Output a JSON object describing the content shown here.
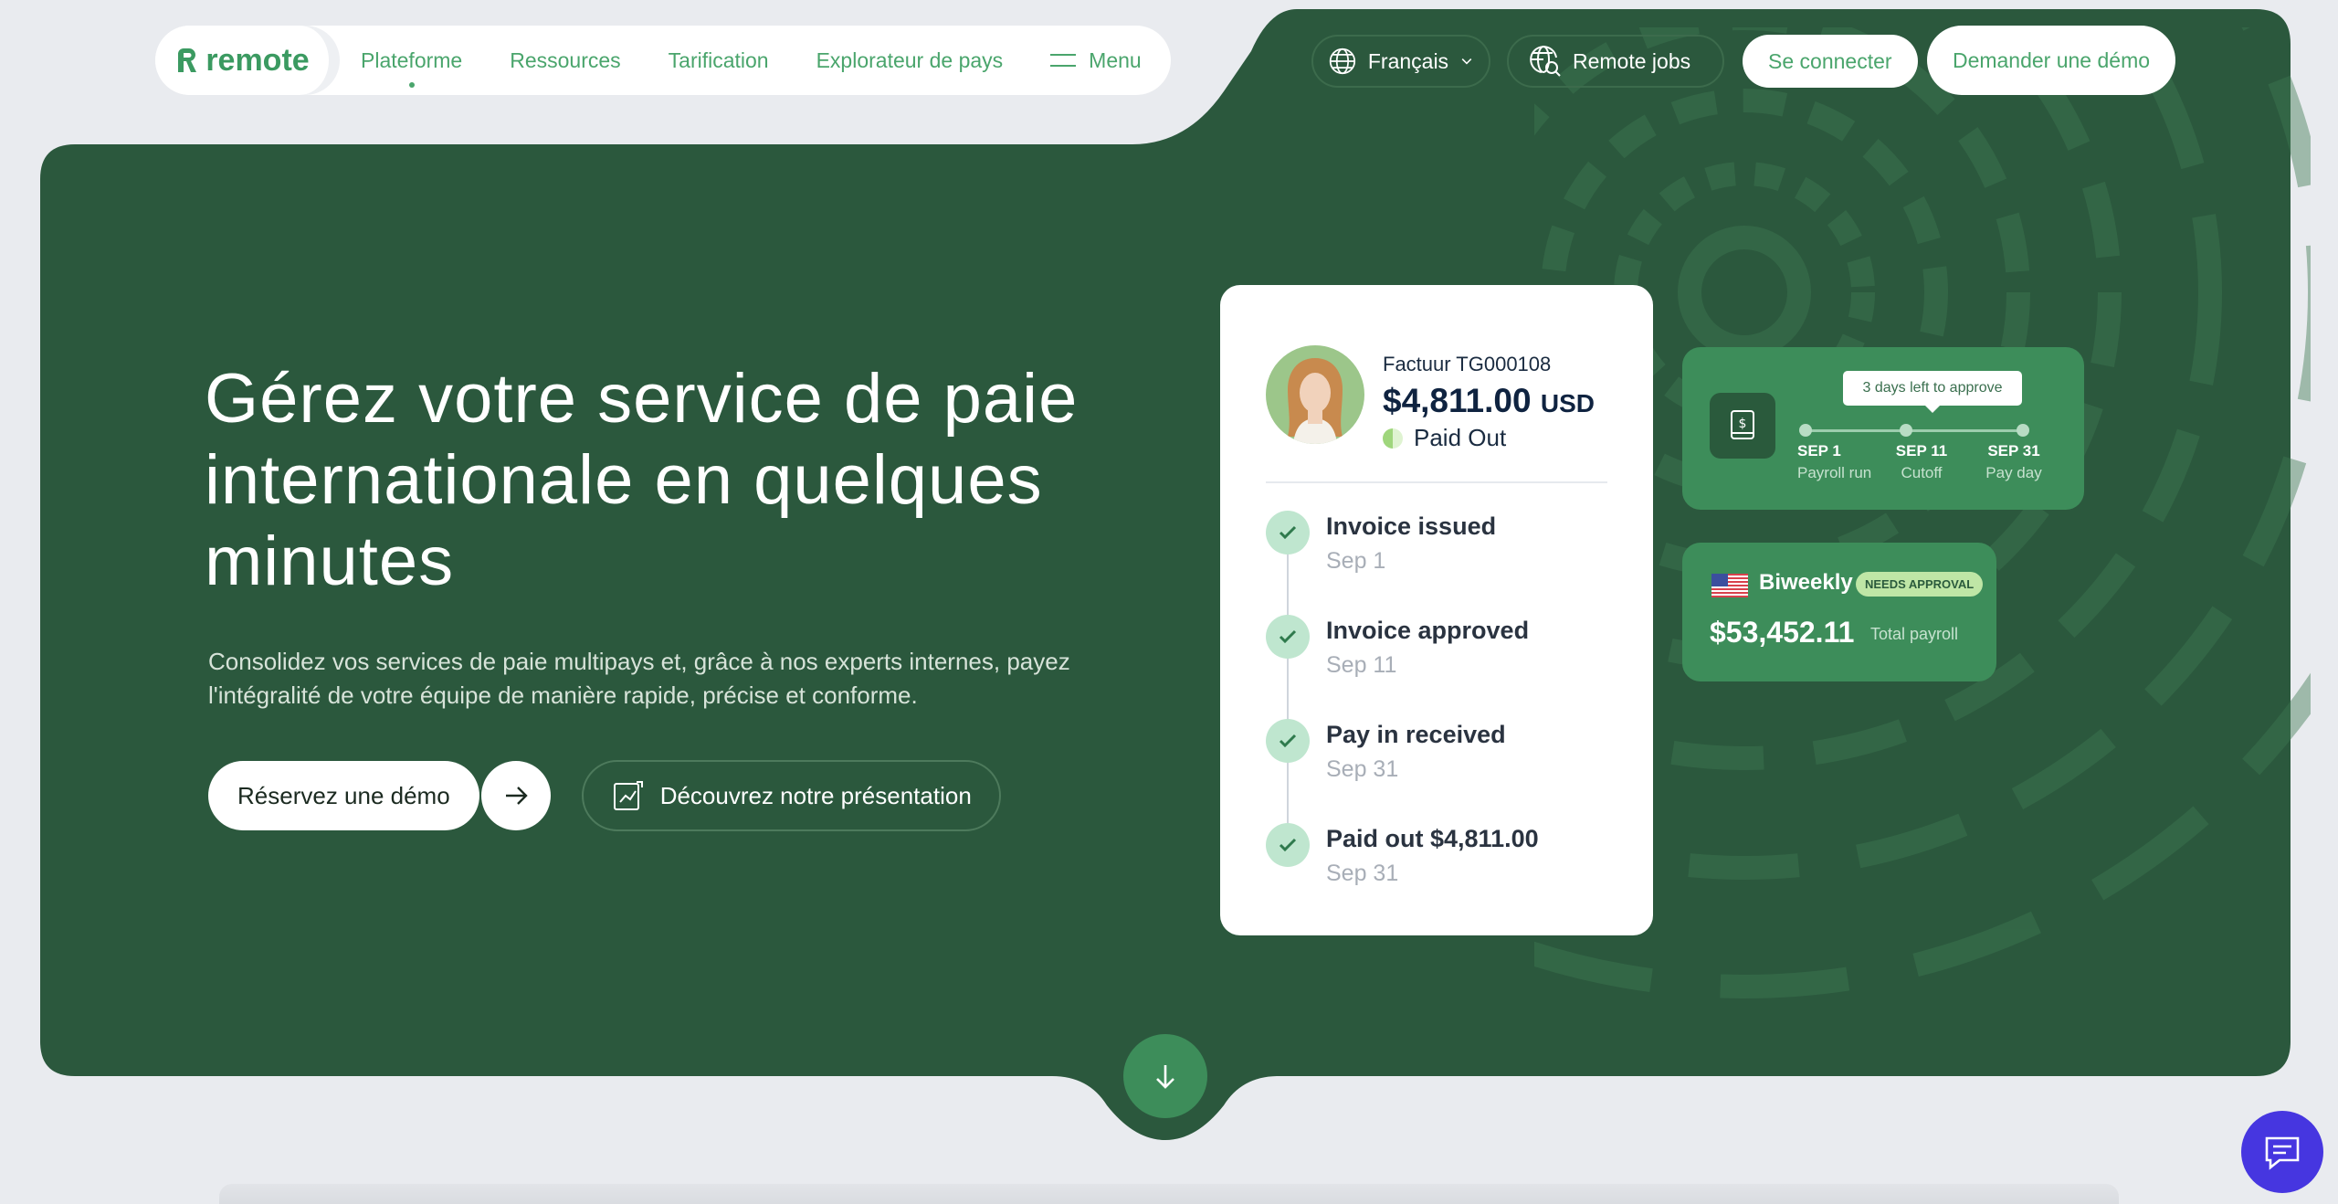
{
  "brand": {
    "name": "remote",
    "color": "#3b9a61",
    "dark_green": "#2a5a3c",
    "hero_bg": "#2b583d",
    "chat_color": "#4636e0"
  },
  "nav": {
    "items": [
      {
        "label": "Plateforme",
        "active": true
      },
      {
        "label": "Ressources"
      },
      {
        "label": "Tarification"
      },
      {
        "label": "Explorateur de pays"
      }
    ],
    "menu_label": "Menu",
    "language": "Français",
    "remote_jobs": "Remote jobs",
    "login": "Se connecter",
    "demo": "Demander une démo"
  },
  "hero": {
    "title": "Gérez votre service de paie internationale en quelques minutes",
    "subtitle": "Consolidez vos services de paie multipays et, grâce à nos experts internes, payez l'intégralité de votre équipe de manière rapide, précise et conforme.",
    "cta_primary": "Réservez une démo",
    "cta_secondary": "Découvrez notre présentation"
  },
  "invoice_card": {
    "invoice_no": "Factuur TG000108",
    "amount": "$4,811.00",
    "currency": "USD",
    "status": "Paid Out",
    "steps": [
      {
        "title": "Invoice issued",
        "date": "Sep 1"
      },
      {
        "title": "Invoice approved",
        "date": "Sep 11"
      },
      {
        "title": "Pay in received",
        "date": "Sep 31"
      },
      {
        "title": "Paid out $4,811.00",
        "date": "Sep 31"
      }
    ]
  },
  "payroll_timeline": {
    "tooltip": "3 days left to approve",
    "points": [
      {
        "date": "SEP 1",
        "label": "Payroll run"
      },
      {
        "date": "SEP 11",
        "label": "Cutoff"
      },
      {
        "date": "SEP 31",
        "label": "Pay day"
      }
    ]
  },
  "payroll_summary": {
    "frequency": "Biweekly",
    "badge": "NEEDS APPROVAL",
    "total": "$53,452.11",
    "total_label": "Total payroll"
  },
  "icons": {
    "globe": "globe-icon",
    "jobs": "globe-search-icon",
    "arrow": "arrow-right-icon",
    "presentation": "presentation-icon",
    "dollar_doc": "dollar-document-icon",
    "check": "check-icon",
    "scroll": "arrow-down-icon",
    "chat": "chat-icon"
  }
}
